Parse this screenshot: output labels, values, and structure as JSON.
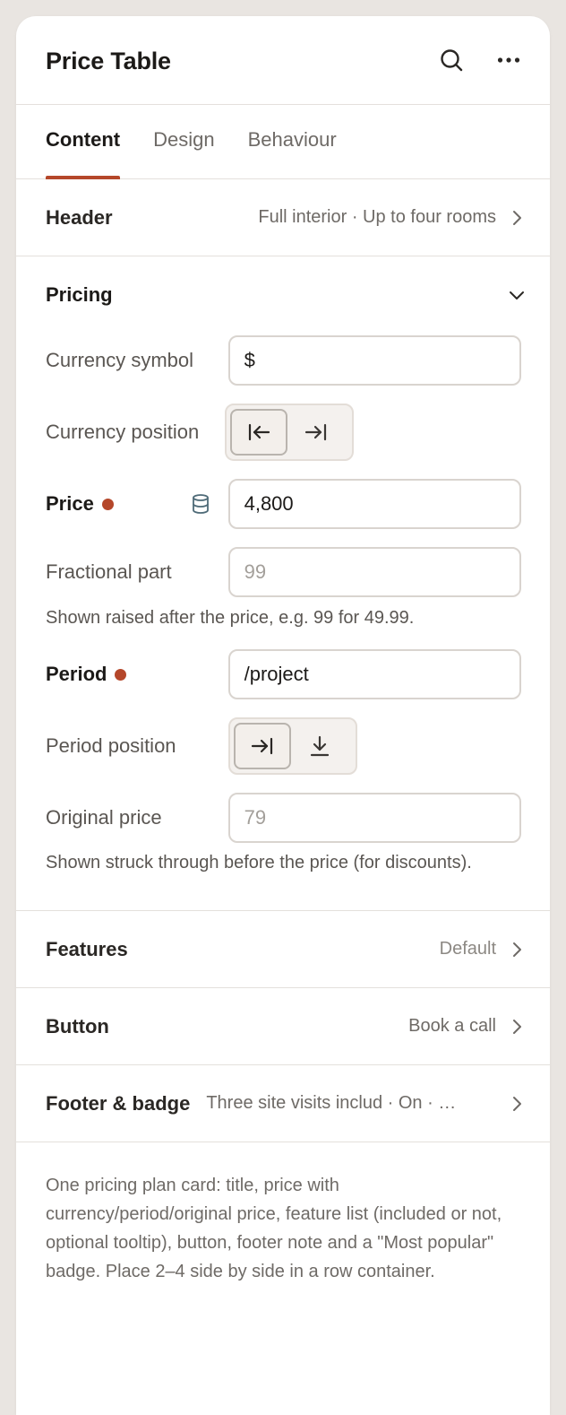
{
  "panel": {
    "title": "Price Table",
    "icons": {
      "search": "search-icon",
      "more": "more-horizontal-icon"
    }
  },
  "tabs": [
    {
      "label": "Content",
      "active": true
    },
    {
      "label": "Design",
      "active": false
    },
    {
      "label": "Behaviour",
      "active": false
    }
  ],
  "sections": {
    "header": {
      "label": "Header",
      "value": "Full interior · Up to four rooms"
    },
    "pricing": {
      "label": "Pricing",
      "currency_symbol": {
        "label": "Currency symbol",
        "value": "$"
      },
      "currency_position": {
        "label": "Currency position",
        "options": [
          "before",
          "after"
        ],
        "selected": "before"
      },
      "price": {
        "label": "Price",
        "value": "4,800"
      },
      "fractional_part": {
        "label": "Fractional part",
        "placeholder": "99",
        "hint": "Shown raised after the price, e.g. 99 for 49.99."
      },
      "period": {
        "label": "Period",
        "value": "/project"
      },
      "period_position": {
        "label": "Period position",
        "options": [
          "inline",
          "below"
        ],
        "selected": "inline"
      },
      "original_price": {
        "label": "Original price",
        "placeholder": "79",
        "hint": "Shown struck through before the price (for discounts)."
      }
    },
    "features": {
      "label": "Features",
      "value": "Default"
    },
    "button": {
      "label": "Button",
      "value": "Book a call"
    },
    "footer_badge": {
      "label": "Footer & badge",
      "value": "Three site visits includ · On · …"
    }
  },
  "description": "One pricing plan card: title, price with currency/period/original price, feature list (included or not, optional tooltip), button, footer note and a \"Most popular\" badge. Place 2–4 side by side in a row container.",
  "colors": {
    "accent": "#b5472a",
    "border": "#e4e0dc",
    "background": "#e9e5e1"
  }
}
